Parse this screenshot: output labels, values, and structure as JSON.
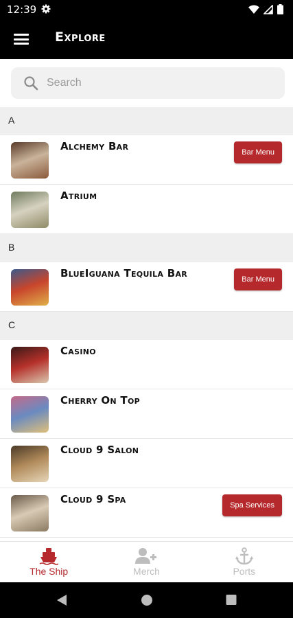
{
  "status_bar": {
    "time": "12:39",
    "icons": [
      "gear-icon",
      "wifi-icon",
      "signal-icon",
      "battery-icon"
    ]
  },
  "app_bar": {
    "title": "Explore",
    "menu_icon": "hamburger-menu-icon"
  },
  "search": {
    "placeholder": "Search",
    "value": ""
  },
  "sections": [
    {
      "letter": "A",
      "items": [
        {
          "name": "Alchemy Bar",
          "action": "Bar Menu",
          "thumb": [
            "#5a3b2a",
            "#c9b39a",
            "#8a5a3c"
          ]
        },
        {
          "name": "Atrium",
          "action": "",
          "thumb": [
            "#6e7a5c",
            "#d6d2c0",
            "#8f8a66"
          ]
        }
      ]
    },
    {
      "letter": "B",
      "items": [
        {
          "name": "BlueIguana Tequila Bar",
          "action": "Bar Menu",
          "thumb": [
            "#3c5a8c",
            "#c8452c",
            "#e0b04a"
          ]
        }
      ]
    },
    {
      "letter": "C",
      "items": [
        {
          "name": "Casino",
          "action": "",
          "thumb": [
            "#3a1a18",
            "#b5302a",
            "#d9c8b0"
          ]
        },
        {
          "name": "Cherry On Top",
          "action": "",
          "thumb": [
            "#c46a8a",
            "#6a8ac0",
            "#e0c07a"
          ]
        },
        {
          "name": "Cloud 9 Salon",
          "action": "",
          "thumb": [
            "#4a3a28",
            "#b08a5a",
            "#e6d6b8"
          ]
        },
        {
          "name": "Cloud 9 Spa",
          "action": "Spa Services",
          "thumb": [
            "#6a5a4a",
            "#d8cab4",
            "#8c7a62"
          ]
        }
      ]
    }
  ],
  "bottom_nav": [
    {
      "label": "The Ship",
      "icon": "ship-icon",
      "active": true
    },
    {
      "label": "Merch",
      "icon": "add-person-icon",
      "active": false
    },
    {
      "label": "Ports",
      "icon": "anchor-icon",
      "active": false
    }
  ],
  "colors": {
    "accent": "#b5282b",
    "inactive": "#bdbdbd",
    "header_bg": "#000000",
    "section_bg": "#efefef"
  }
}
